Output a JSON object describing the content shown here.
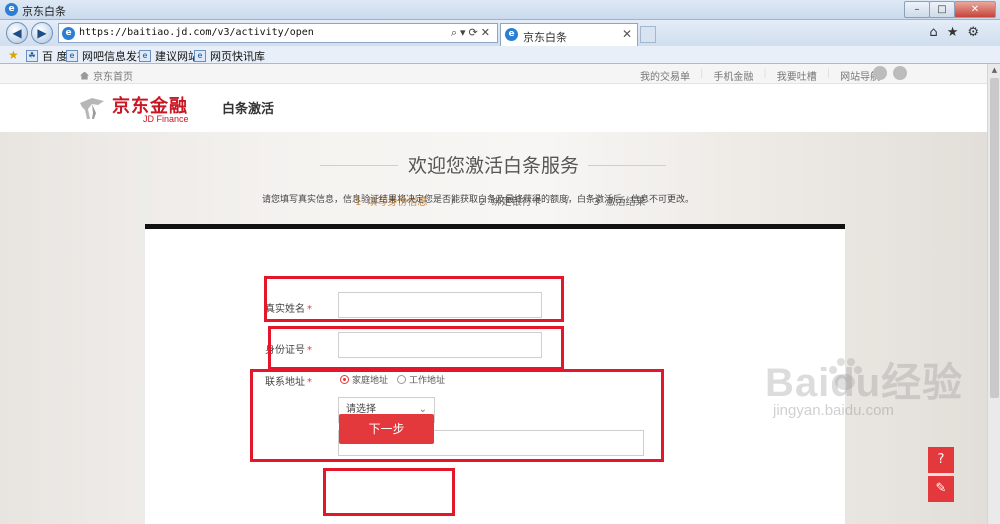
{
  "window": {
    "title": "京东白条"
  },
  "browser": {
    "url": "https://baitiao.jd.com/v3/activity/open",
    "tab_label": "京东白条",
    "favorites": [
      "百 度",
      "网吧信息发布",
      "建议网站",
      "网页快讯库"
    ]
  },
  "site": {
    "home_link": "京东首页",
    "top_links": [
      "我的交易单",
      "手机金融",
      "我要吐槽",
      "网站导航"
    ],
    "logo_cn": "京东金融",
    "logo_en": "JD Finance",
    "page_name": "白条激活"
  },
  "hero": {
    "welcome": "欢迎您激活白条服务",
    "steps": [
      {
        "num": "1",
        "label": "填写身份信息",
        "active": true
      },
      {
        "num": "2",
        "label": "绑定银行卡",
        "active": false
      },
      {
        "num": "3",
        "label": "激活结果",
        "active": false
      }
    ]
  },
  "form": {
    "notice": "请您填写真实信息，信息验证结果将决定您是否能获取白条及最终获得的额度，白条激活后，信息不可更改。",
    "name_label": "真实姓名",
    "id_label": "身份证号",
    "address_label": "联系地址",
    "required_mark": "*",
    "address_types": [
      "家庭地址",
      "工作地址"
    ],
    "select_placeholder": "请选择",
    "next_button": "下一步"
  },
  "watermark": {
    "brand": "Baidu经验",
    "domain": "jingyan.baidu.com"
  },
  "colors": {
    "accent": "#e4393c",
    "brand": "#c81623",
    "step_active": "#c8873b",
    "annotation": "#e3162a"
  }
}
